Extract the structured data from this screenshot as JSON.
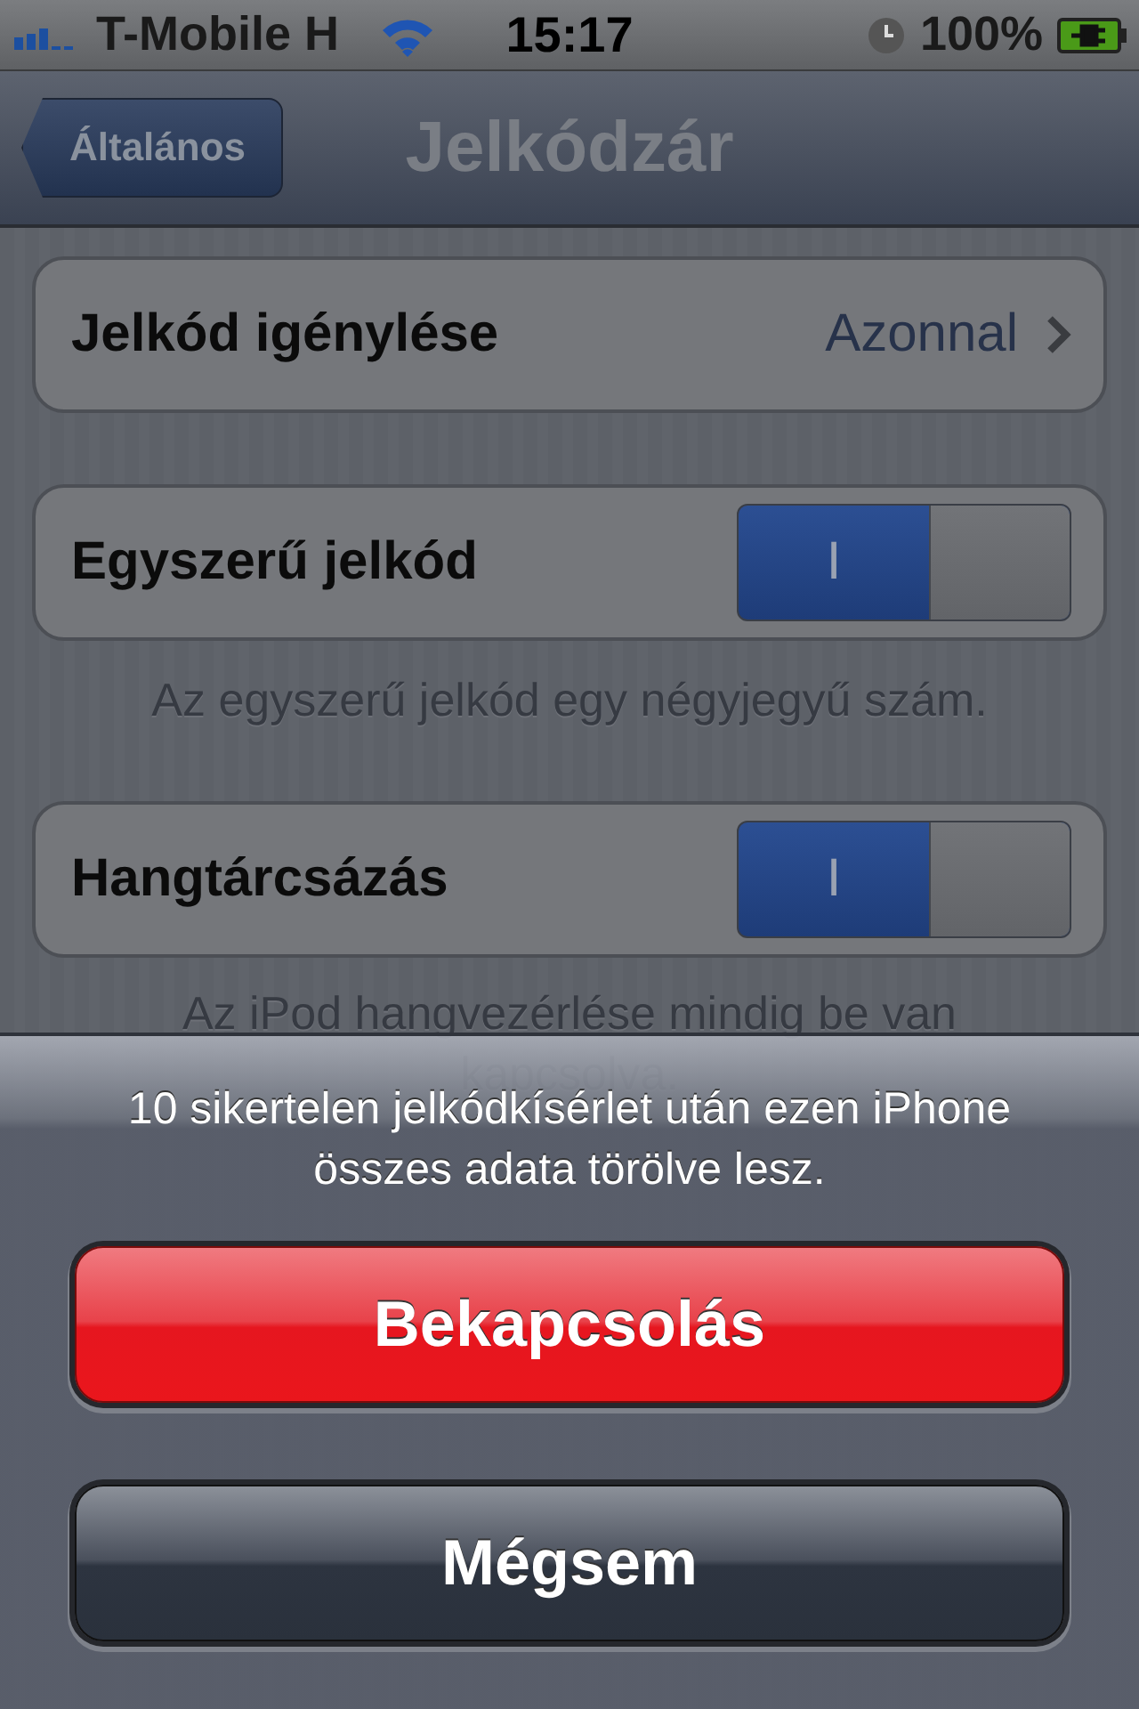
{
  "status_bar": {
    "carrier": "T-Mobile H",
    "time": "15:17",
    "battery": "100%"
  },
  "nav_bar": {
    "back": "Általános",
    "title": "Jelkódzár"
  },
  "groups": [
    {
      "rows": [
        {
          "kind": "disclosure",
          "label": "Jelkód igénylése",
          "value": "Azonnal"
        }
      ]
    },
    {
      "rows": [
        {
          "kind": "switch",
          "label": "Egyszerű jelkód",
          "on": true,
          "on_label": "I"
        }
      ],
      "footer": "Az egyszerű jelkód egy négyjegyű szám."
    },
    {
      "rows": [
        {
          "kind": "switch",
          "label": "Hangtárcsázás",
          "on": true,
          "on_label": "I"
        }
      ],
      "footer": "Az iPod hangvezérlése mindig be van kapcsolva."
    }
  ],
  "action_sheet": {
    "message": "10 sikertelen jelkódkísérlet után ezen iPhone összes adata törölve lesz.",
    "buttons": [
      {
        "label": "Bekapcsolás",
        "kind": "destructive"
      },
      {
        "label": "Mégsem",
        "kind": "cancel"
      }
    ]
  }
}
